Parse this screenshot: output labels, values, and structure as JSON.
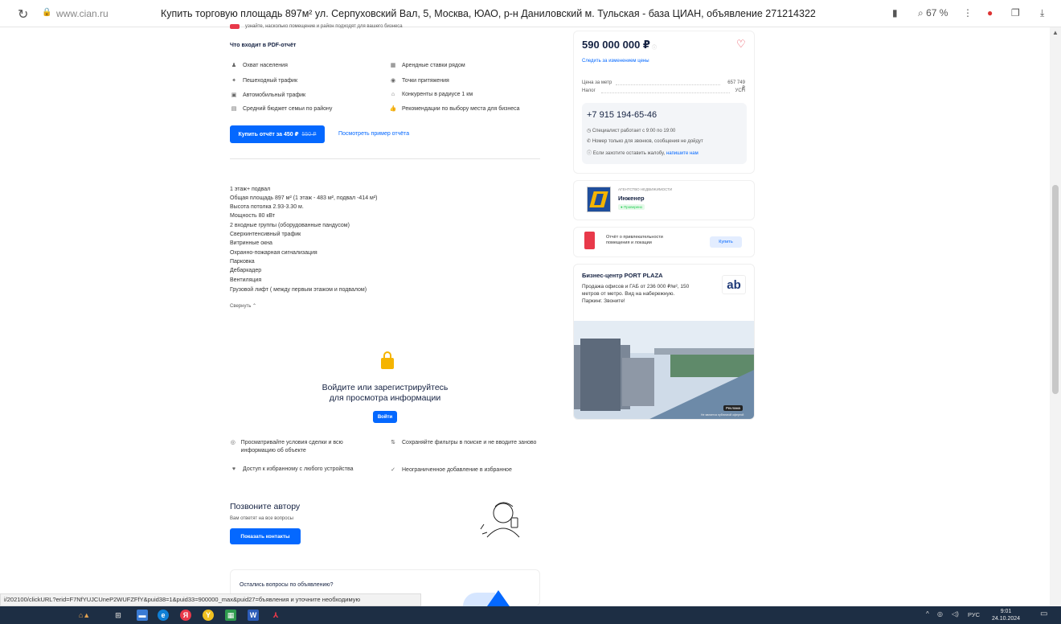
{
  "browser": {
    "url": "www.cian.ru",
    "title": "Купить торговую площадь 897м² ул. Серпуховский Вал, 5, Москва, ЮАО, р-н Даниловский м. Тульская - база ЦИАН, объявление 271214322",
    "zoom": "67 %"
  },
  "top_partial_text": "узнайте, насколько помещение и район подходят для вашего бизнеса",
  "pdf": {
    "heading": "Что входит в PDF-отчёт",
    "left_features": [
      {
        "icon": "person-icon",
        "label": "Охват населения"
      },
      {
        "icon": "walker-icon",
        "label": "Пешеходный трафик"
      },
      {
        "icon": "car-icon",
        "label": "Автомобильный трафик"
      },
      {
        "icon": "wallet-icon",
        "label": "Средний бюджет семьи по району"
      }
    ],
    "right_features": [
      {
        "icon": "document-icon",
        "label": "Арендные ставки рядом"
      },
      {
        "icon": "target-icon",
        "label": "Точки притяжения"
      },
      {
        "icon": "building-icon",
        "label": "Конкуренты в радиусе 1 км"
      },
      {
        "icon": "thumbs-up-icon",
        "label": "Рекомендации по выбору места для бизнеса"
      }
    ],
    "buy_button": "Купить отчёт за 450 ₽",
    "buy_button_old": "550 ₽",
    "example_link": "Посмотреть пример отчёта"
  },
  "description": {
    "lines": [
      "1 этаж+ подвал",
      "Общая площадь 897 м² (1 этаж - 483 м², подвал -414 м²)",
      "Высота потолка 2.93-3.30 м.",
      "Мощность 80 кВт",
      "2 входные группы (оборудованные пандусом)",
      "Сверхинтенсивный трафик",
      "Витринные окна",
      "Охранно-пожарная сигнализация",
      "Парковка",
      "Дебаркадер",
      "Вентиляция",
      "Грузовой лифт ( между первым этажом и подвалом)"
    ],
    "collapse": "Свернуть"
  },
  "login": {
    "title_line1": "Войдите или зарегистрируйтесь",
    "title_line2": "для просмотра информации",
    "button": "Войти",
    "benefits": [
      {
        "icon": "eye-icon",
        "label": "Просматривайте условия сделки и всю информацию об объекте"
      },
      {
        "icon": "filter-icon",
        "label": "Сохраняйте фильтры в поиске и не вводите заново"
      },
      {
        "icon": "heart-icon",
        "label": "Доступ к избранному с любого устройства"
      },
      {
        "icon": "check-icon",
        "label": "Неограниченное добавление в избранное"
      }
    ]
  },
  "call": {
    "title": "Позвоните автору",
    "subtitle": "Вам ответят на все вопросы",
    "button": "Показать контакты"
  },
  "questions": {
    "title": "Остались вопросы по объявлению?",
    "text": "бъявления и уточните необходимую"
  },
  "sidebar": {
    "price": "590 000 000 ₽",
    "watch_price": "Следить за изменением цены",
    "rows": [
      {
        "label": "Цена за метр",
        "value": "657 749 ₽"
      },
      {
        "label": "Налог",
        "value": "УСН"
      }
    ],
    "phone": "+7 915 194-65-46",
    "notes": [
      {
        "icon": "clock-icon",
        "text": "Специалист работает с 9:00 по 19:00"
      },
      {
        "icon": "phone-icon",
        "text": "Номер только для звонков, сообщения не дойдут"
      },
      {
        "icon": "info-icon",
        "text": "Если захотите оставить жалобу,",
        "link": "напишите нам"
      }
    ],
    "agency_type": "АГЕНТСТВО НЕДВИЖИМОСТИ",
    "agency_name": "Инженер",
    "agency_badge": "Проверено",
    "report_text_line1": "Отчёт о привлекательности",
    "report_text_line2": "помещения и локации",
    "report_button": "Купить",
    "ad_title": "Бизнес-центр PORT PLAZA",
    "ad_text_line1": "Продажа офисов и ГАБ от 236 000 ₽/м², 150",
    "ad_text_line2": "метров от метро. Вид на набережную.",
    "ad_text_line3": "Паркинг. Звоните!",
    "ad_logo": "ab",
    "ad_label": "Реклама",
    "ad_caption": "Не является публичной офертой"
  },
  "status_url": "i/202100/clickURL?erid=F7NfYUJCUneP2WUFZFfY&puid38=1&puid33=900000_max&puid27=",
  "taskbar": {
    "lang": "РУС",
    "time": "9:01",
    "date": "24.10.2024"
  },
  "colors": {
    "accent": "#0468ff",
    "taskbar": "#1d2e44",
    "green": "#1ecd4d"
  }
}
